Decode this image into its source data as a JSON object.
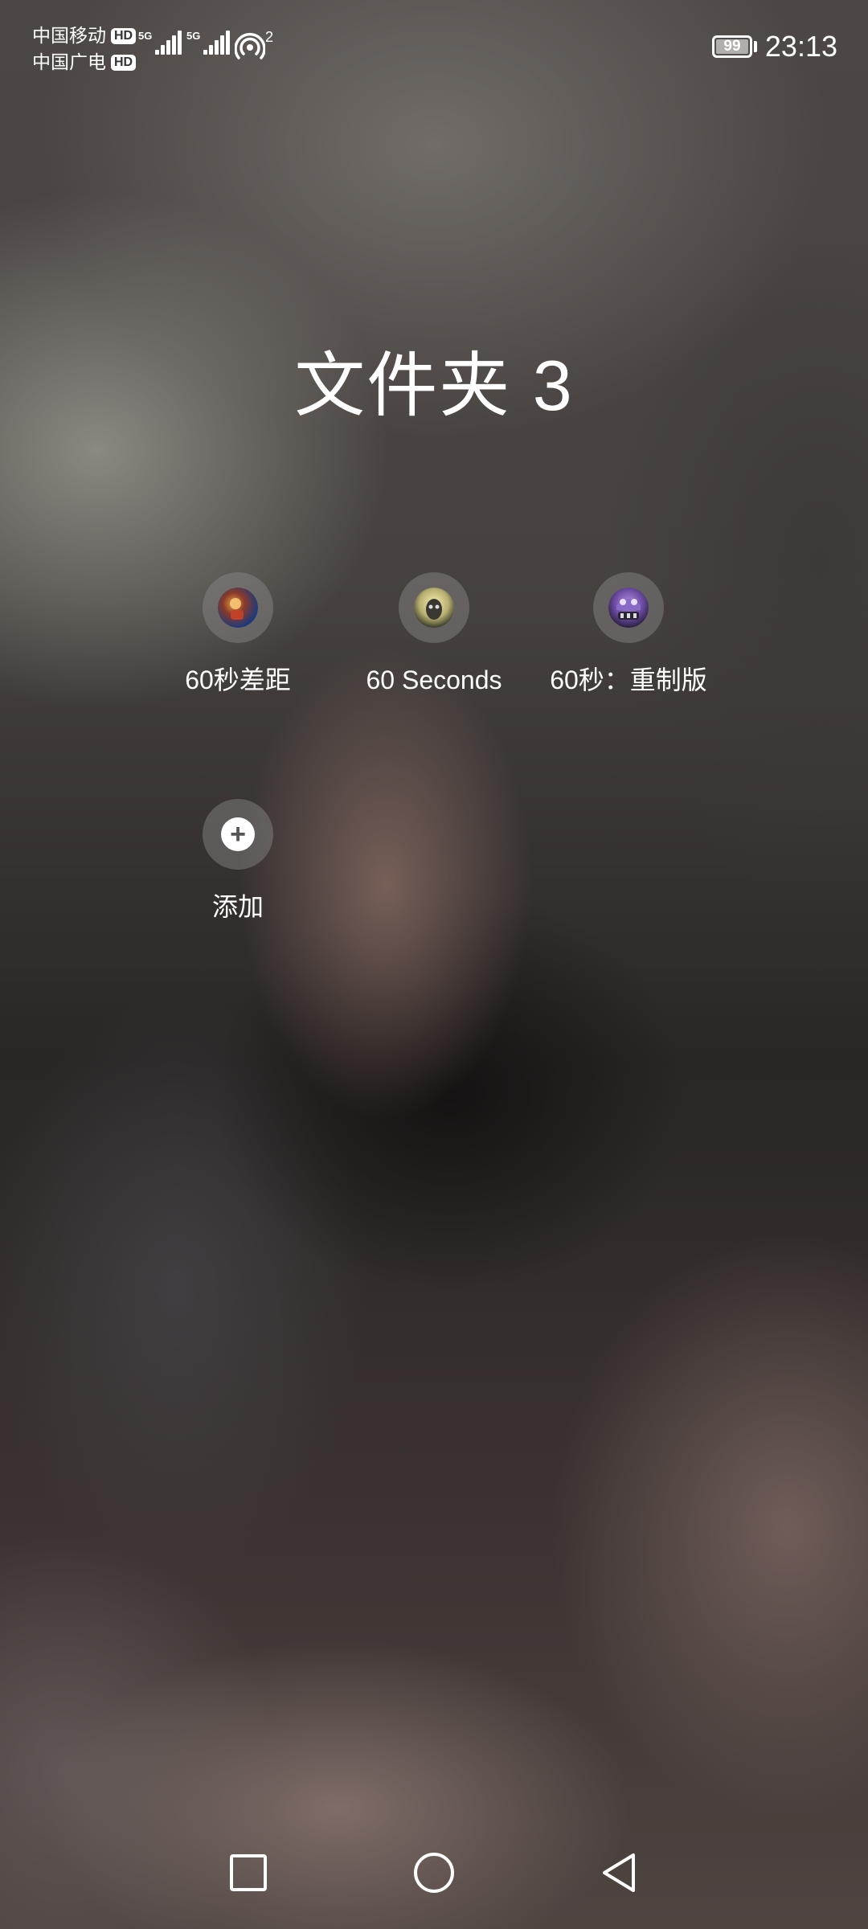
{
  "status_bar": {
    "carrier_1": "中国移动",
    "carrier_2": "中国广电",
    "hd_label": "HD",
    "network_1": "5G",
    "network_2": "5G",
    "hotspot_count": "2",
    "battery_level": "99",
    "time": "23:13"
  },
  "folder": {
    "title": "文件夹 3",
    "apps": [
      {
        "label": "60秒差距",
        "icon": "60-parsecs-app-icon"
      },
      {
        "label": "60 Seconds",
        "icon": "60-seconds-app-icon"
      },
      {
        "label": "60秒：重制版",
        "icon": "60-seconds-reatomized-app-icon"
      }
    ],
    "add": {
      "label": "添加",
      "icon": "plus-icon"
    }
  },
  "nav_bar": {
    "recent_icon": "square-icon",
    "home_icon": "circle-icon",
    "back_icon": "triangle-back-icon"
  },
  "colors": {
    "text": "#ffffff",
    "icon_circle_bg": "#8c8c8c"
  }
}
